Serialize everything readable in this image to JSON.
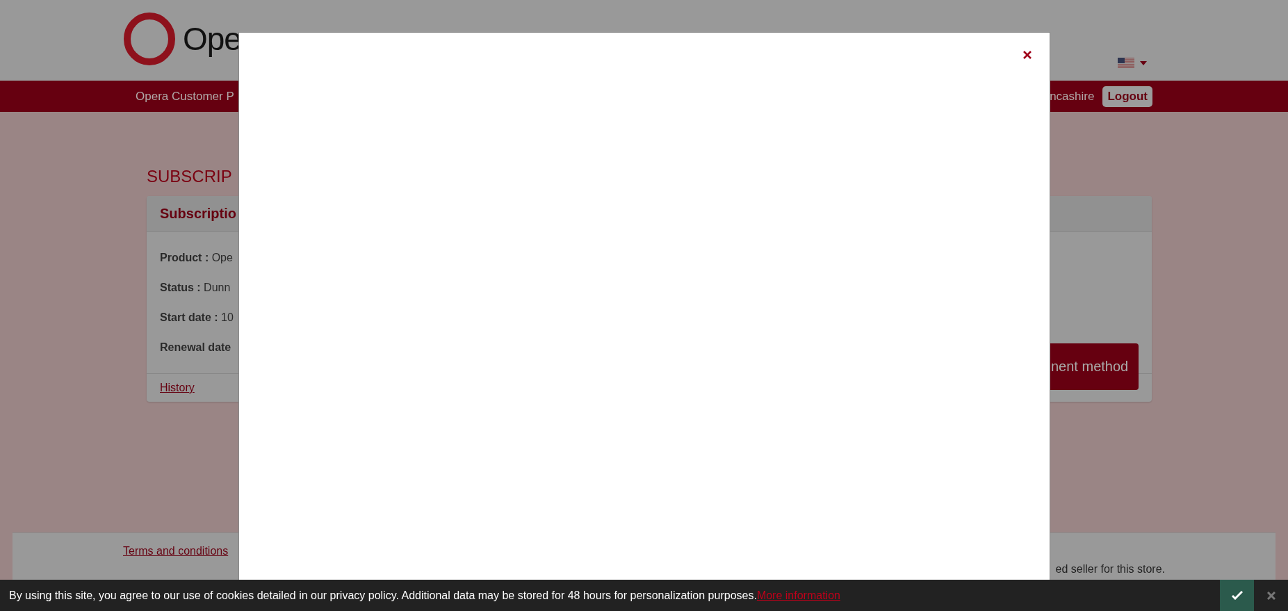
{
  "header": {
    "logo_text": "Ope"
  },
  "nav": {
    "left": "Opera Customer P",
    "user": "ncashire",
    "logout": "Logout"
  },
  "page_title": "SUBSCRIP",
  "card": {
    "title": "Subscriptio",
    "fields": [
      {
        "label": "Product :",
        "value": "Ope"
      },
      {
        "label": "Status :",
        "value": "Dunn"
      },
      {
        "label": "Start date :",
        "value": "10"
      },
      {
        "label": "Renewal date"
      }
    ],
    "button": "nent method",
    "footer_link": "History"
  },
  "footer": {
    "link": "Terms and conditions",
    "text": "ed seller for this store."
  },
  "cookie_bar": {
    "text": "By using this site, you agree to our use of cookies detailed in our privacy policy. Additional data may be stored for 48 hours for personalization purposes.",
    "link": "More information"
  }
}
